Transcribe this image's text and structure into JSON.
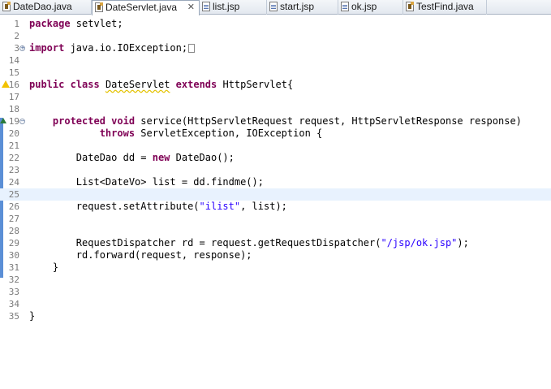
{
  "tabs": [
    {
      "label": "DateDao.java",
      "icon": "java-file-icon",
      "active": false
    },
    {
      "label": "DateServlet.java",
      "icon": "java-file-icon",
      "active": true
    },
    {
      "label": "list.jsp",
      "icon": "jsp-file-icon",
      "active": false
    },
    {
      "label": "start.jsp",
      "icon": "jsp-file-icon",
      "active": false
    },
    {
      "label": "ok.jsp",
      "icon": "jsp-file-icon",
      "active": false
    },
    {
      "label": "TestFind.java",
      "icon": "java-file-icon",
      "active": false
    }
  ],
  "close_glyph": "✕",
  "editor": {
    "current_line": 25,
    "lines": [
      {
        "n": "1",
        "segs": [
          [
            "kw",
            "package"
          ],
          [
            "t",
            " setvlet;"
          ]
        ]
      },
      {
        "n": "2",
        "segs": []
      },
      {
        "n": "3",
        "fold": "+",
        "segs": [
          [
            "kw",
            "import"
          ],
          [
            "t",
            " java.io.IOException;"
          ]
        ],
        "collapsed": true
      },
      {
        "n": "14",
        "segs": []
      },
      {
        "n": "15",
        "segs": []
      },
      {
        "n": "16",
        "warn": true,
        "segs": [
          [
            "kw",
            "public"
          ],
          [
            "t",
            " "
          ],
          [
            "kw",
            "class"
          ],
          [
            "t",
            " "
          ],
          [
            "sq",
            "DateServlet"
          ],
          [
            "t",
            " "
          ],
          [
            "kw",
            "extends"
          ],
          [
            "t",
            " HttpServlet{"
          ]
        ]
      },
      {
        "n": "17",
        "segs": []
      },
      {
        "n": "18",
        "segs": []
      },
      {
        "n": "19",
        "fold": "−",
        "override": true,
        "segs": [
          [
            "t",
            "    "
          ],
          [
            "kw",
            "protected"
          ],
          [
            "t",
            " "
          ],
          [
            "kw",
            "void"
          ],
          [
            "t",
            " service(HttpServletRequest request, HttpServletResponse response)"
          ]
        ]
      },
      {
        "n": "20",
        "segs": [
          [
            "t",
            "            "
          ],
          [
            "kw",
            "throws"
          ],
          [
            "t",
            " ServletException, IOException {"
          ]
        ]
      },
      {
        "n": "21",
        "segs": []
      },
      {
        "n": "22",
        "segs": [
          [
            "t",
            "        DateDao dd = "
          ],
          [
            "kw",
            "new"
          ],
          [
            "t",
            " DateDao();"
          ]
        ]
      },
      {
        "n": "23",
        "segs": []
      },
      {
        "n": "24",
        "segs": [
          [
            "t",
            "        List<DateVo> list = dd.findme();"
          ]
        ]
      },
      {
        "n": "25",
        "segs": []
      },
      {
        "n": "26",
        "segs": [
          [
            "t",
            "        request.setAttribute("
          ],
          [
            "str",
            "\"ilist\""
          ],
          [
            "t",
            ", list);"
          ]
        ]
      },
      {
        "n": "27",
        "segs": []
      },
      {
        "n": "28",
        "segs": []
      },
      {
        "n": "29",
        "segs": [
          [
            "t",
            "        RequestDispatcher rd = request.getRequestDispatcher("
          ],
          [
            "str",
            "\"/jsp/ok.jsp\""
          ],
          [
            "t",
            ");"
          ]
        ]
      },
      {
        "n": "30",
        "segs": [
          [
            "t",
            "        rd.forward(request, response);"
          ]
        ]
      },
      {
        "n": "31",
        "segs": [
          [
            "t",
            "    }"
          ]
        ]
      },
      {
        "n": "32",
        "segs": []
      },
      {
        "n": "33",
        "segs": []
      },
      {
        "n": "34",
        "segs": []
      },
      {
        "n": "35",
        "segs": [
          [
            "t",
            "}"
          ]
        ]
      }
    ]
  },
  "colors": {
    "keyword": "#7f0055",
    "string": "#2a00ff",
    "current_line": "#e8f2fe",
    "line_number": "#7a7a7a"
  }
}
